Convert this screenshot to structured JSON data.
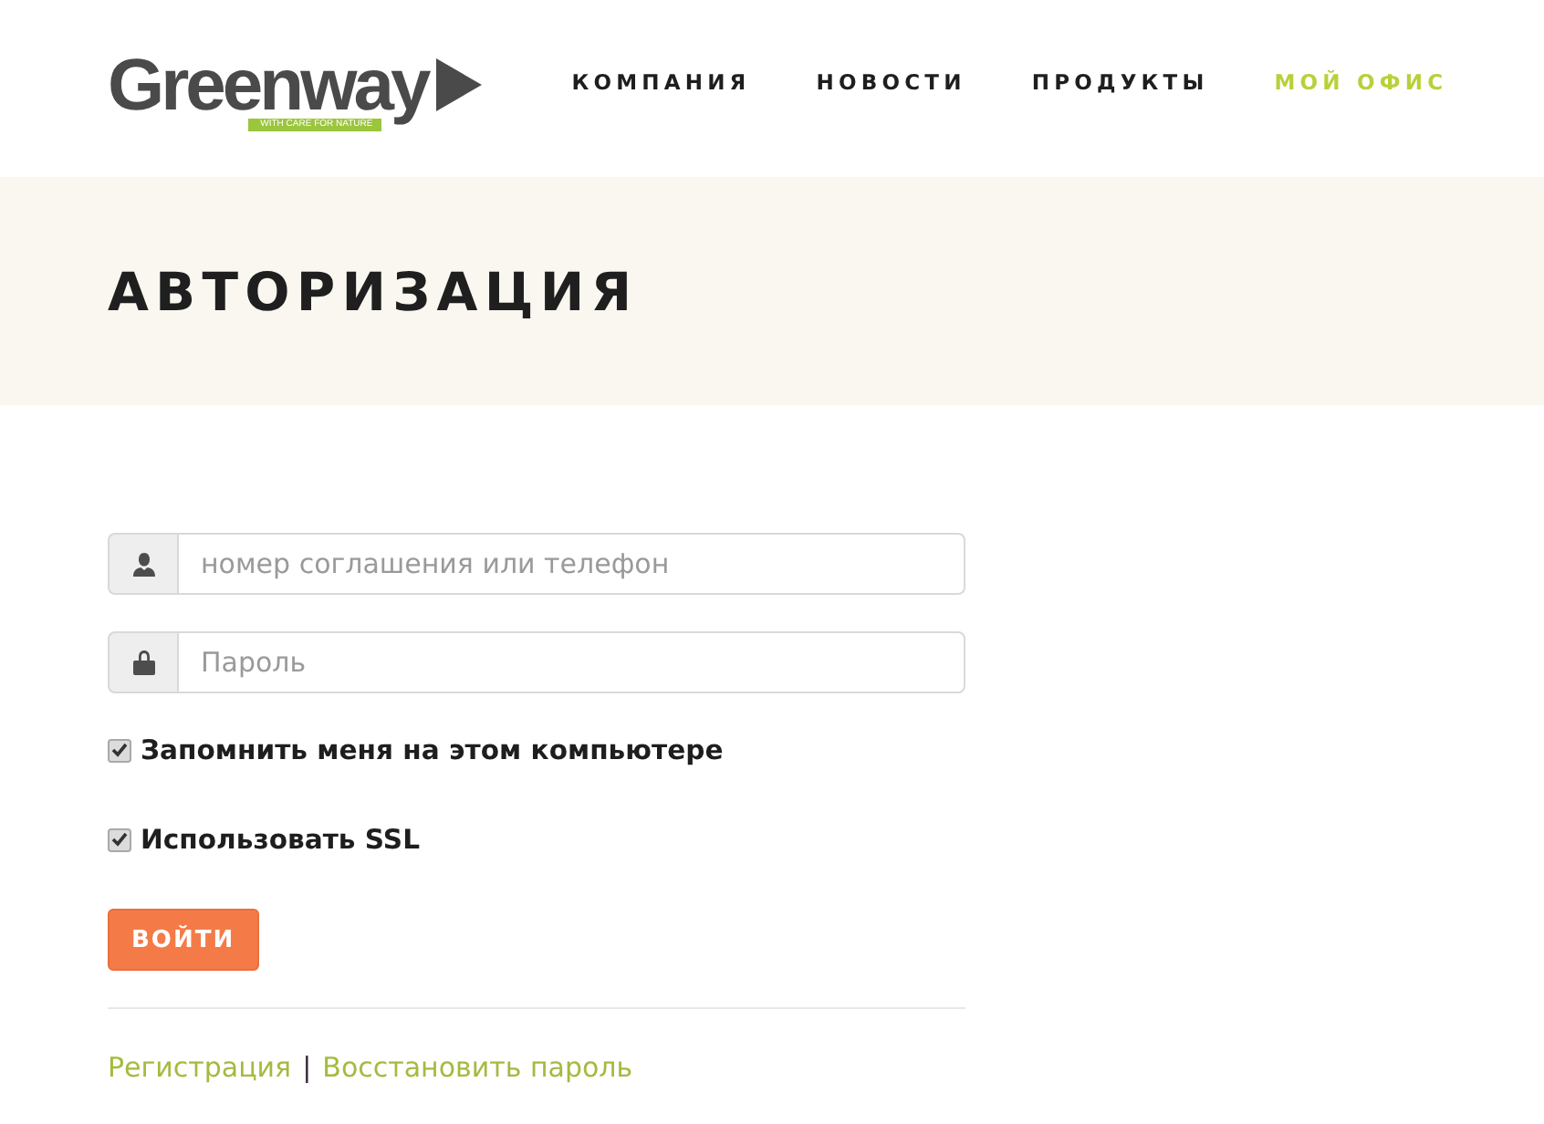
{
  "header": {
    "logo": {
      "name": "Greenway",
      "tagline": "WITH CARE FOR NATURE"
    },
    "nav": [
      {
        "label": "КОМПАНИЯ",
        "selected": false
      },
      {
        "label": "НОВОСТИ",
        "selected": false
      },
      {
        "label": "ПРОДУКТЫ",
        "selected": false
      },
      {
        "label": "МОЙ ОФИС",
        "selected": true
      }
    ]
  },
  "banner": {
    "title": "АВТОРИЗАЦИЯ"
  },
  "form": {
    "fields": [
      {
        "kind": "user",
        "placeholder": "номер соглашения или телефон"
      },
      {
        "kind": "password",
        "placeholder": "Пароль"
      }
    ],
    "options": [
      {
        "label": "Запомнить меня на этом компьютере",
        "checked": true
      },
      {
        "label": "Использовать SSL",
        "checked": true
      }
    ],
    "submit": "ВОЙТИ",
    "links": [
      "Регистрация",
      "Восстановить пароль"
    ],
    "separator": "|"
  }
}
